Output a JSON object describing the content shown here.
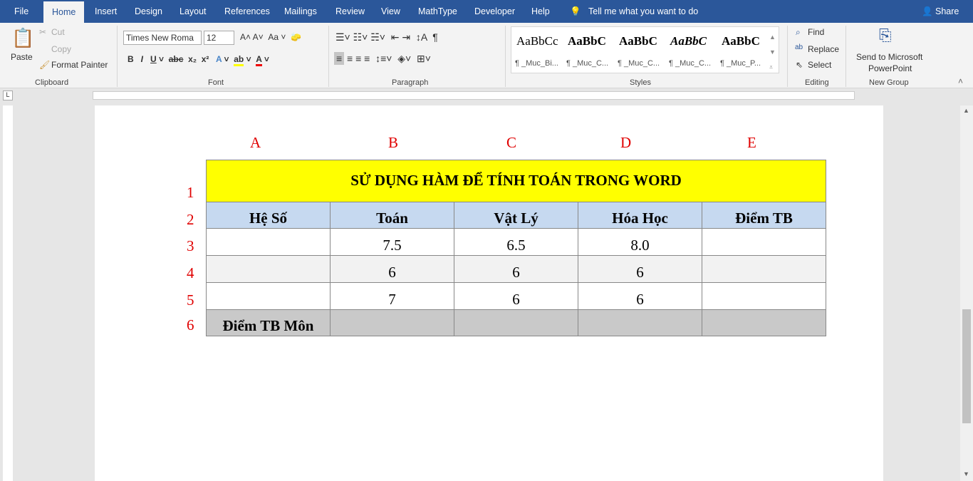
{
  "tabs": [
    "File",
    "Home",
    "Insert",
    "Design",
    "Layout",
    "References",
    "Mailings",
    "Review",
    "View",
    "MathType",
    "Developer",
    "Help"
  ],
  "tell_me": "Tell me what you want to do",
  "share": "Share",
  "clipboard": {
    "paste": "Paste",
    "cut": "Cut",
    "copy": "Copy",
    "format_painter": "Format Painter",
    "group": "Clipboard"
  },
  "font": {
    "name": "Times New Roma",
    "size": "12",
    "group": "Font"
  },
  "paragraph": {
    "group": "Paragraph"
  },
  "styles": {
    "group": "Styles",
    "items": [
      {
        "preview": "AaBbCc",
        "label": "¶ _Muc_Bi..."
      },
      {
        "preview": "AaBbC",
        "label": "¶ _Muc_C..."
      },
      {
        "preview": "AaBbC",
        "label": "¶ _Muc_C..."
      },
      {
        "preview": "AaBbC",
        "label": "¶ _Muc_C..."
      },
      {
        "preview": "AaBbC",
        "label": "¶ _Muc_P..."
      }
    ]
  },
  "editing": {
    "find": "Find",
    "replace": "Replace",
    "select": "Select",
    "group": "Editing"
  },
  "newgroup": {
    "send": "Send to Microsoft",
    "send2": "PowerPoint",
    "group": "New Group"
  },
  "columns": [
    "A",
    "B",
    "C",
    "D",
    "E"
  ],
  "rows": [
    "1",
    "2",
    "3",
    "4",
    "5",
    "6"
  ],
  "table": {
    "title": "SỬ DỤNG HÀM ĐỂ TÍNH TOÁN TRONG WORD",
    "headers": [
      "Hệ Số",
      "Toán",
      "Vật Lý",
      "Hóa Học",
      "Điểm TB"
    ],
    "data": [
      [
        "",
        "7.5",
        "6.5",
        "8.0",
        ""
      ],
      [
        "",
        "6",
        "6",
        "6",
        ""
      ],
      [
        "",
        "7",
        "6",
        "6",
        ""
      ]
    ],
    "footer": "Điểm TB Môn"
  }
}
